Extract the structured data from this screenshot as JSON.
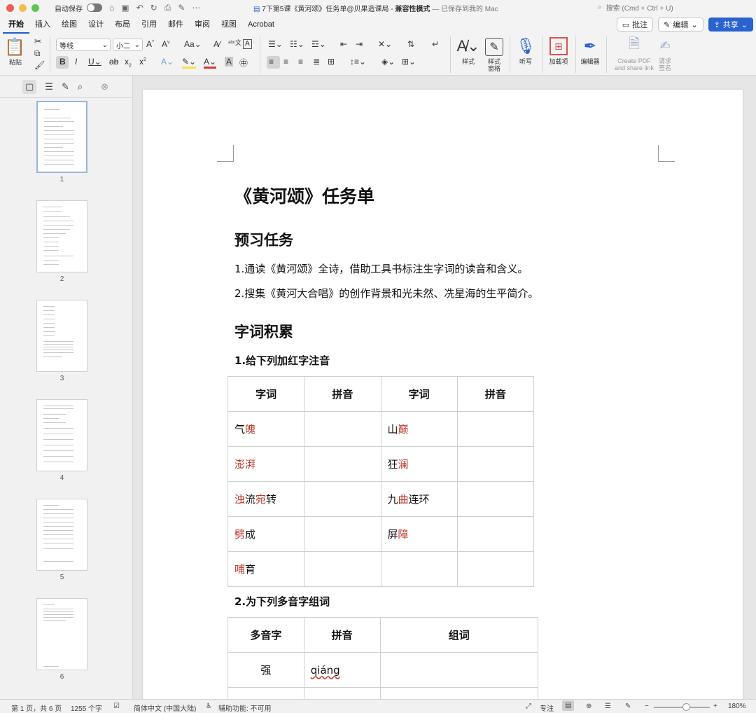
{
  "titlebar": {
    "autosave_label": "自动保存",
    "doc_name": "7下第5课《黄河颂》任务单@贝果造课局",
    "mode": "兼容性模式",
    "saved_status": "— 已保存到我的 Mac",
    "search_placeholder": "搜索 (Cmd + Ctrl + U)",
    "traffic_colors": [
      "#ec5f56",
      "#f4bd4f",
      "#61c554"
    ]
  },
  "menu": {
    "tabs": [
      "开始",
      "插入",
      "绘图",
      "设计",
      "布局",
      "引用",
      "邮件",
      "审阅",
      "视图",
      "Acrobat"
    ],
    "active": "开始",
    "comment_label": "批注",
    "edit_label": "编辑",
    "share_label": "共享"
  },
  "ribbon": {
    "paste_label": "粘贴",
    "font_name": "等线",
    "font_size": "小二",
    "styles_label": "样式",
    "styles_pane_label": "样式\n窗格",
    "dictate_label": "听写",
    "addins_label": "加载项",
    "editor_label": "编辑器",
    "create_pdf_label": "Create PDF\nand share link",
    "request_sign_label": "请求\n签名"
  },
  "sidebar": {
    "page_numbers": [
      "1",
      "2",
      "3",
      "4",
      "5",
      "6"
    ]
  },
  "document": {
    "title": "《黄河颂》任务单",
    "section1": "预习任务",
    "task1": "1.通读《黄河颂》全诗，借助工具书标注生字词的读音和含义。",
    "task2": "2.搜集《黄河大合唱》的创作背景和光未然、冼星海的生平简介。",
    "section2": "字词积累",
    "q1": "1.给下列加红字注音",
    "table1": {
      "headers": [
        "字词",
        "拼音",
        "字词",
        "拼音"
      ],
      "rows": [
        [
          [
            "气",
            ""
          ],
          [
            "魄",
            "red"
          ],
          [
            "山",
            ""
          ],
          [
            "巅",
            "red"
          ]
        ],
        [
          [
            "",
            ""
          ],
          [
            "澎湃",
            "red"
          ],
          [
            "狂",
            ""
          ],
          [
            "澜",
            "red"
          ]
        ],
        [
          [
            "",
            ""
          ],
          [
            "浊",
            "red"
          ],
          [
            "流",
            ""
          ],
          [
            "宛",
            "red"
          ],
          [
            "转",
            ""
          ]
        ],
        [
          [
            "",
            ""
          ],
          [
            "劈",
            "red"
          ],
          [
            "成",
            ""
          ]
        ],
        [
          [
            "",
            ""
          ],
          [
            "哺",
            "red"
          ],
          [
            "育",
            ""
          ]
        ]
      ]
    },
    "q2": "2.为下列多音字组词",
    "table2": {
      "headers": [
        "多音字",
        "拼音",
        "组词"
      ],
      "char": "强",
      "pinyin": "qiáng"
    }
  },
  "t1": {
    "r1a1": "气",
    "r1a2": "魄",
    "r1b1": "山",
    "r1b2": "巅",
    "r2a1": "澎湃",
    "r2b1": "狂",
    "r2b2": "澜",
    "r3a1": "浊",
    "r3a2": "流",
    "r3a3": "宛",
    "r3a4": "转",
    "r3b1": "九",
    "r3b2": "曲",
    "r3b3": "连环",
    "r4a1": "劈",
    "r4a2": "成",
    "r4b1": "屏",
    "r4b2": "障",
    "r5a1": "哺",
    "r5a2": "育"
  },
  "statusbar": {
    "page_info": "第 1 页，共 6 页",
    "word_count": "1255 个字",
    "language": "简体中文 (中国大陆)",
    "accessibility": "辅助功能: 不可用",
    "focus_label": "专注",
    "zoom": "180%",
    "zoom_level_percent": 180
  }
}
